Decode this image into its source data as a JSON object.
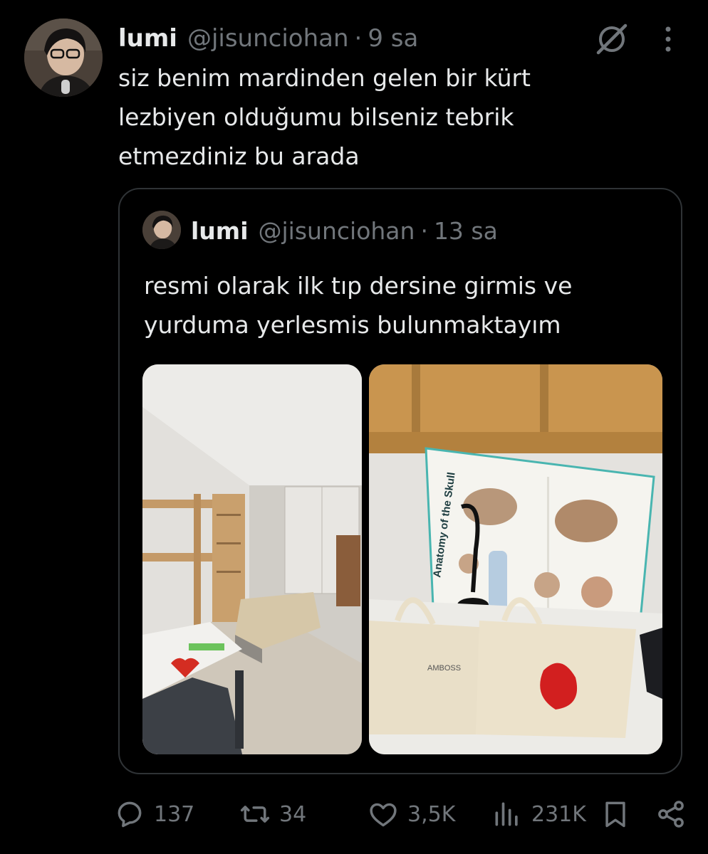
{
  "tweet": {
    "author": {
      "name": "lumi",
      "handle": "@jisunciohan"
    },
    "separator": "·",
    "time": "9 sa",
    "text": "siz benim mardinden gelen bir kürt\nlezbiyen olduğumu bilseniz tebrik\netmezdiniz bu arada",
    "icons": {
      "grok": "grok-icon",
      "more": "more-dots-icon"
    }
  },
  "quote": {
    "author": {
      "name": "lumi",
      "handle": "@jisunciohan"
    },
    "separator": "·",
    "time": "13 sa",
    "text": "resmi olarak ilk tıp dersine girmis ve\nyurduma yerlesmis bulunmaktayım",
    "media": [
      {
        "name": "dorm-room-photo"
      },
      {
        "name": "desk-anatomy-poster-photo",
        "poster_title": "Anatomy of the Skull",
        "brand": "AMBOSS"
      }
    ]
  },
  "actions": {
    "replies": "137",
    "retweets": "34",
    "likes": "3,5K",
    "views": "231K",
    "icons": [
      "reply-icon",
      "retweet-icon",
      "like-icon",
      "views-icon",
      "bookmark-icon",
      "share-icon"
    ]
  },
  "colors": {
    "background": "#000000",
    "text": "#e7e9ea",
    "muted": "#71767b",
    "border": "#2f3336"
  }
}
